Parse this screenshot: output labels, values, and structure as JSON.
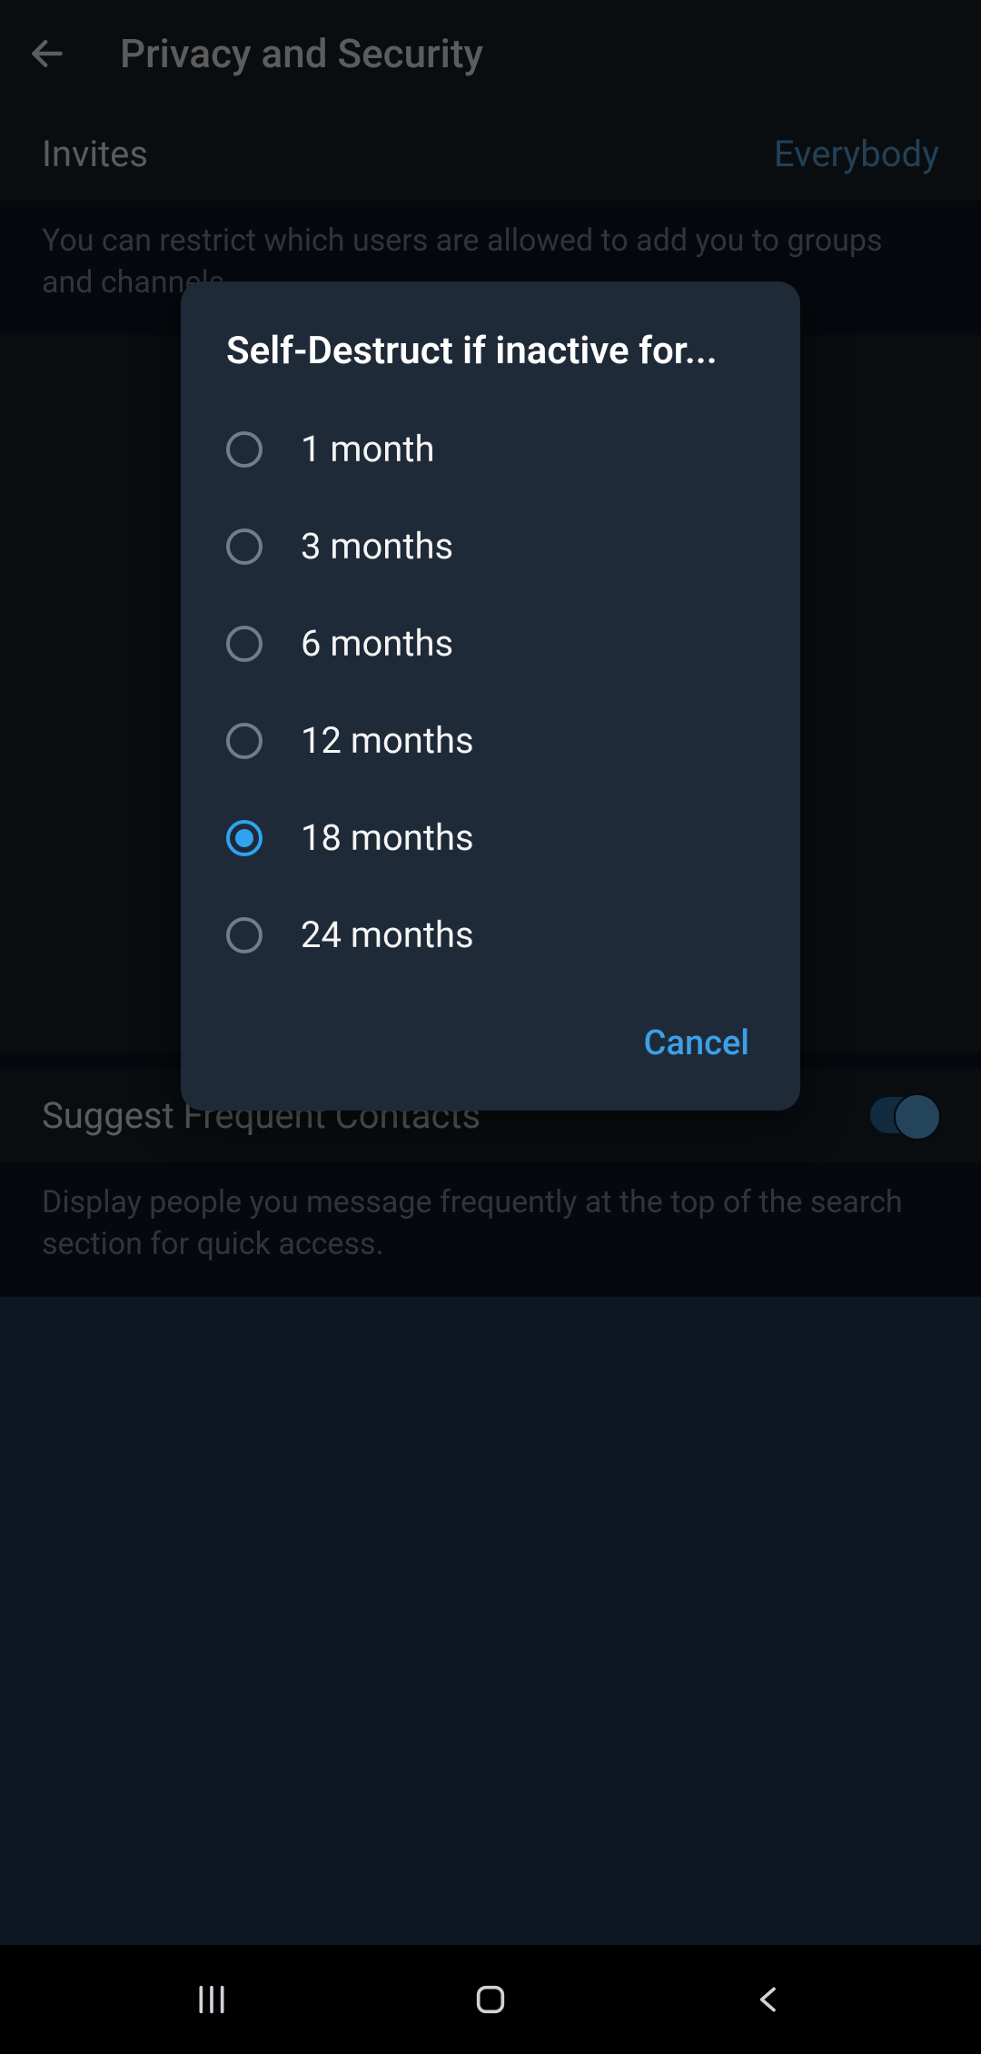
{
  "header": {
    "title": "Privacy and Security"
  },
  "settings": {
    "invites": {
      "label": "Invites",
      "value": "Everybody",
      "description": "You can restrict which users are allowed to add you to groups and channels."
    },
    "suggestContacts": {
      "label": "Suggest Frequent Contacts",
      "description": "Display people you message frequently at the top of the search section for quick access."
    }
  },
  "dialog": {
    "title": "Self-Destruct if inactive for...",
    "options": [
      {
        "label": "1 month",
        "selected": false
      },
      {
        "label": "3 months",
        "selected": false
      },
      {
        "label": "6 months",
        "selected": false
      },
      {
        "label": "12 months",
        "selected": false
      },
      {
        "label": "18 months",
        "selected": true
      },
      {
        "label": "24 months",
        "selected": false
      }
    ],
    "cancel": "Cancel"
  }
}
